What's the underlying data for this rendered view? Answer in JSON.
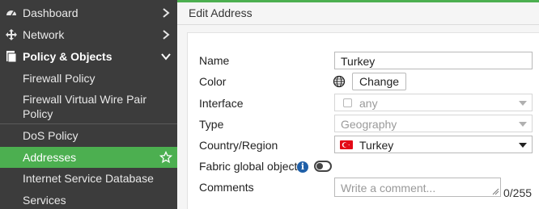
{
  "sidebar": {
    "items": [
      {
        "label": "Dashboard",
        "icon": "dashboard-icon"
      },
      {
        "label": "Network",
        "icon": "network-icon"
      },
      {
        "label": "Policy & Objects",
        "icon": "policy-icon"
      }
    ],
    "sub_items": [
      {
        "label": "Firewall Policy"
      },
      {
        "label": "Firewall Virtual Wire Pair Policy"
      },
      {
        "label": "DoS Policy"
      },
      {
        "label": "Addresses",
        "active": true
      },
      {
        "label": "Internet Service Database"
      },
      {
        "label": "Services"
      }
    ]
  },
  "header": {
    "title": "Edit Address"
  },
  "form": {
    "name": {
      "label": "Name",
      "value": "Turkey"
    },
    "color": {
      "label": "Color",
      "button": "Change"
    },
    "interface": {
      "label": "Interface",
      "value": "any"
    },
    "type": {
      "label": "Type",
      "value": "Geography"
    },
    "country": {
      "label": "Country/Region",
      "value": "Turkey"
    },
    "fabric": {
      "label": "Fabric global object",
      "info": "i"
    },
    "comments": {
      "label": "Comments",
      "placeholder": "Write a comment...",
      "counter": "0/255"
    }
  },
  "colors": {
    "accent": "#4caf50",
    "sidebar_bg": "#3c3c3c",
    "flag_red": "#e30a17",
    "info_blue": "#1f5fa8"
  }
}
